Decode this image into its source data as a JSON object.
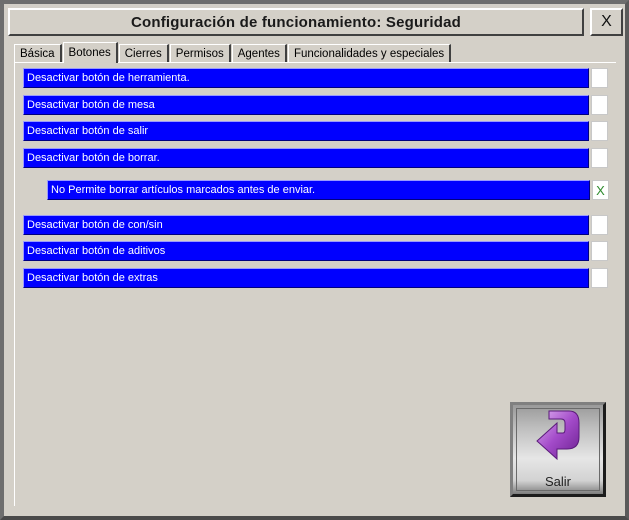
{
  "window": {
    "title": "Configuración de funcionamiento: Seguridad",
    "close_label": "X"
  },
  "tabs": [
    {
      "label": "Básica"
    },
    {
      "label": "Botones",
      "active": true
    },
    {
      "label": "Cierres"
    },
    {
      "label": "Permisos"
    },
    {
      "label": "Agentes"
    },
    {
      "label": "Funcionalidades y especiales"
    }
  ],
  "options": [
    {
      "label": "Desactivar botón de herramienta.",
      "checked": false
    },
    {
      "label": "Desactivar botón de mesa",
      "checked": false
    },
    {
      "label": "Desactivar botón de salir",
      "checked": false
    },
    {
      "label": "Desactivar botón de borrar.",
      "checked": false
    },
    {
      "label": "No Permite borrar artículos marcados antes de enviar.",
      "checked": true,
      "mark": "X"
    },
    {
      "label": "Desactivar botón de con/sin",
      "checked": false
    },
    {
      "label": "Desactivar botón de aditivos",
      "checked": false
    },
    {
      "label": "Desactivar botón de extras",
      "checked": false
    }
  ],
  "salir": {
    "label": "Salir",
    "icon": "curved-arrow-icon"
  },
  "colors": {
    "option_bar": "#0000ff",
    "check_mark": "#2e8b2e",
    "icon_purple": "#a34bc9"
  }
}
